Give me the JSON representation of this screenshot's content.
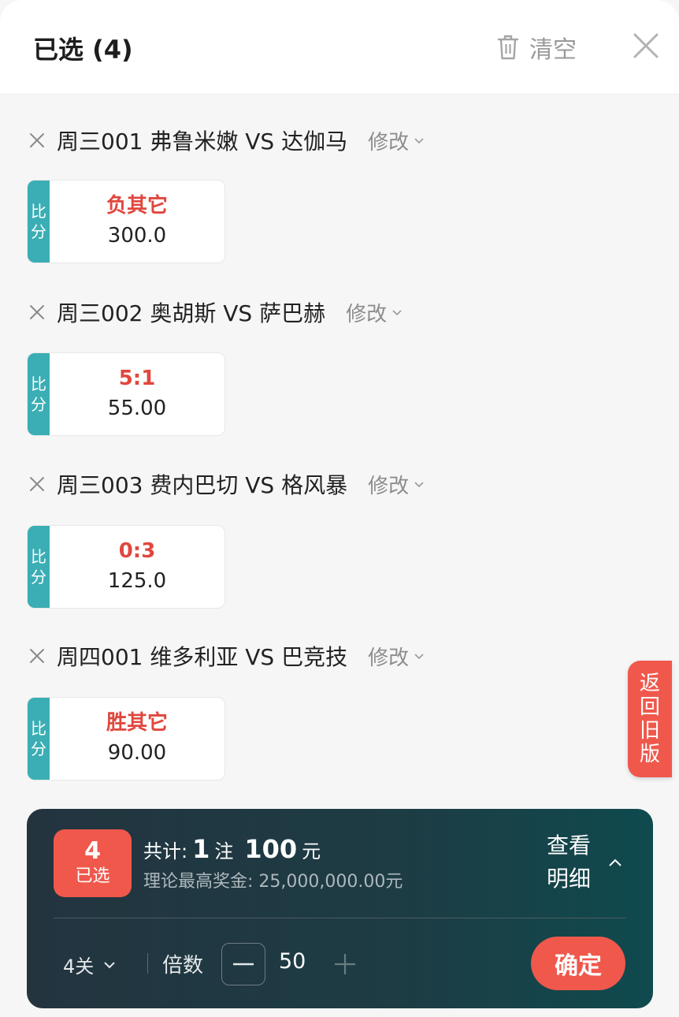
{
  "header": {
    "title": "已选 (4)",
    "clear_label": "清空"
  },
  "matches": [
    {
      "title": "周三001  弗鲁米嫩 VS 达伽马",
      "modify_label": "修改",
      "play_type": [
        "比",
        "分"
      ],
      "option": "负其它",
      "odds": "300.0"
    },
    {
      "title": "周三002  奥胡斯 VS 萨巴赫",
      "modify_label": "修改",
      "play_type": [
        "比",
        "分"
      ],
      "option": "5:1",
      "odds": "55.00"
    },
    {
      "title": "周三003  费内巴切 VS 格风暴",
      "modify_label": "修改",
      "play_type": [
        "比",
        "分"
      ],
      "option": "0:3",
      "odds": "125.0"
    },
    {
      "title": "周四001  维多利亚 VS 巴竞技",
      "modify_label": "修改",
      "play_type": [
        "比",
        "分"
      ],
      "option": "胜其它",
      "odds": "90.00"
    }
  ],
  "side_button": {
    "chars": [
      "返",
      "回",
      "旧",
      "版"
    ]
  },
  "footer": {
    "selected_count": "4",
    "selected_label": "已选",
    "total_prefix": "共计:",
    "bet_count": "1",
    "bet_unit": "注",
    "amount": "100",
    "amount_unit": "元",
    "max_prize": "理论最高奖金: 25,000,000.00元",
    "detail_line1": "查看",
    "detail_line2": "明细",
    "pass_type": "4关",
    "multiplier_label": "倍数",
    "multiplier_value": "50",
    "confirm_label": "确定"
  },
  "colors": {
    "accent_red": "#f0584c",
    "tag_teal": "#3aaeb4",
    "option_red": "#e0473e",
    "footer_dark": "#23343f"
  },
  "icons": [
    "trash-icon",
    "close-icon",
    "remove-icon",
    "chevron-down-icon",
    "chevron-up-icon",
    "minus-icon",
    "plus-icon"
  ]
}
